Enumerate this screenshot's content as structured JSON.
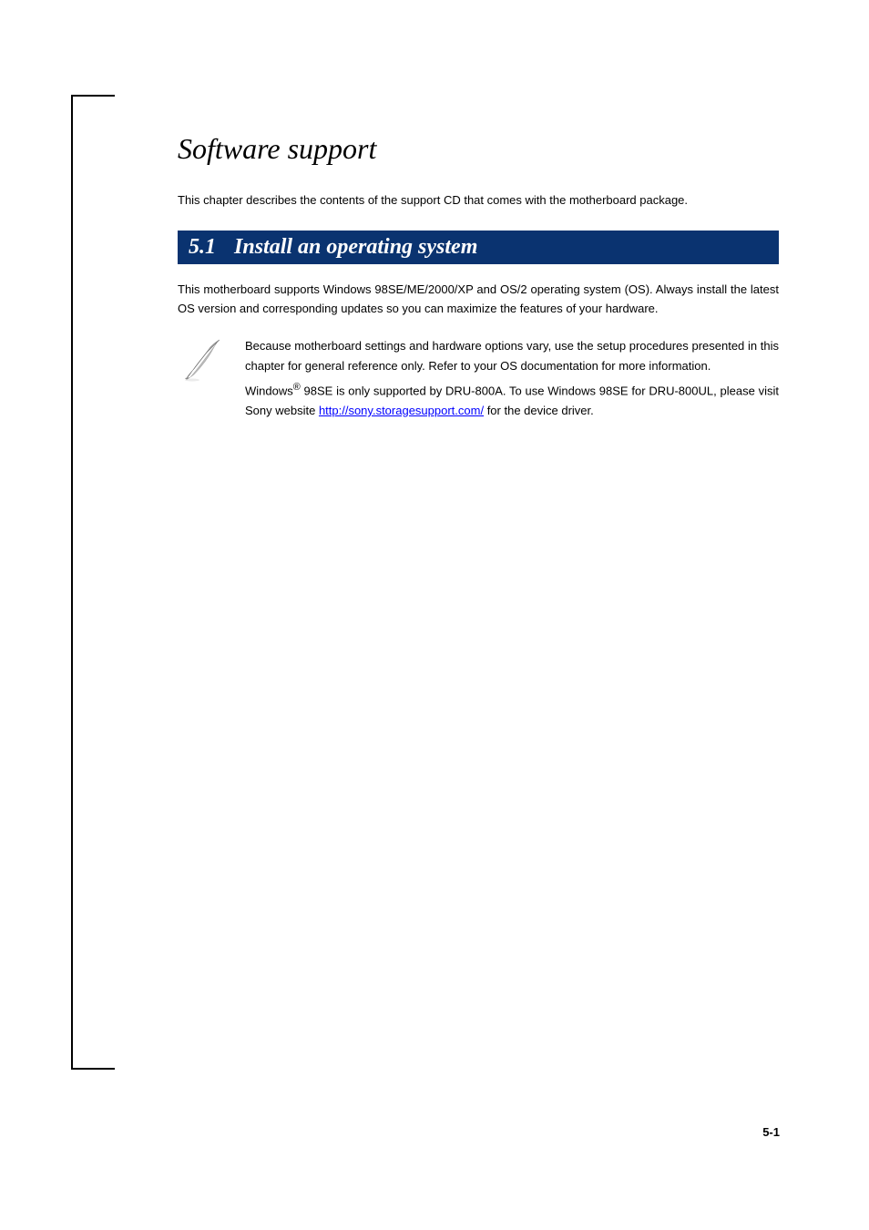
{
  "title": "Software support",
  "intro": "This chapter describes the contents of the support CD that comes with the motherboard package.",
  "section": {
    "number": "5.1",
    "title": "Install an operating system"
  },
  "para1": "This motherboard supports Windows 98SE/ME/2000/XP and OS/2 operating system (OS). Always install the latest OS version and corresponding updates so you can maximize the features of your hardware.",
  "para2": "",
  "note1": "Because motherboard settings and hardware options vary, use the setup procedures presented in this chapter for general reference only. Refer to your OS documentation for more information.",
  "note2_pre": "Windows",
  "note2_sup": "®",
  "note2_post": " 98SE is only supported by DRU-800A. To use Windows 98SE for DRU-800UL, please visit Sony website ",
  "note2_link": "http://sony.storagesupport.com/",
  "note2_after": " for the device driver.",
  "page": "5-1"
}
